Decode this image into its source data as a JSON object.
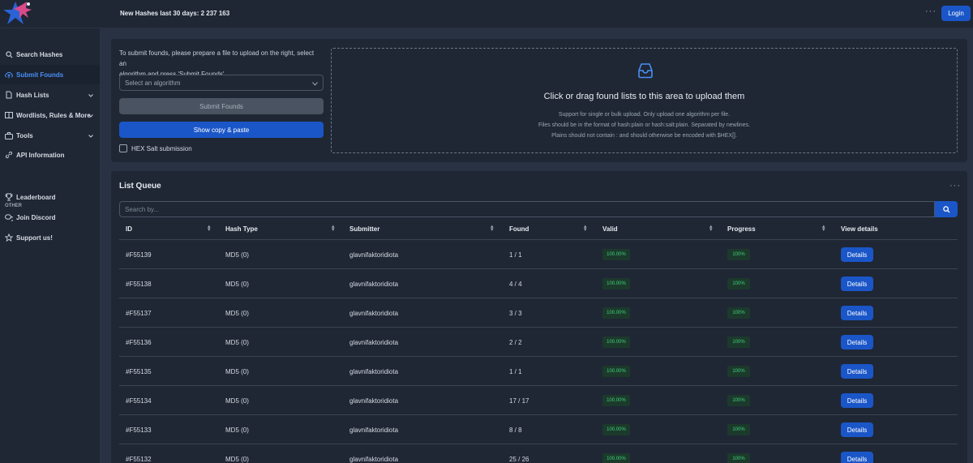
{
  "header": {
    "hashes_stat": "New Hashes last 30 days: 2 237 163",
    "more_label": "···",
    "login_label": "Login"
  },
  "sidebar": {
    "items": [
      {
        "label": "Search Hashes",
        "icon": "search-icon"
      },
      {
        "label": "Submit Founds",
        "icon": "cloud-upload-icon"
      },
      {
        "label": "Hash Lists",
        "icon": "file-icon"
      },
      {
        "label": "Wordlists, Rules & More",
        "icon": "book-icon"
      },
      {
        "label": "Tools",
        "icon": "toolbox-icon"
      },
      {
        "label": "API Information",
        "icon": "link-icon"
      }
    ],
    "section_label": "OTHER",
    "other_items": [
      {
        "label": "Leaderboard",
        "icon": "trophy-icon"
      },
      {
        "label": "Join Discord",
        "icon": "chat-icon"
      },
      {
        "label": "Support us!",
        "icon": "star-icon"
      }
    ]
  },
  "submit": {
    "intro_line1": "To submit founds, please prepare a file to upload on the right, select an",
    "intro_line2": "algorithm and press 'Submit Founds'.",
    "select_placeholder": "Select an algorithm",
    "submit_label": "Submit Founds",
    "copy_label": "Show copy & paste",
    "hex_label": "HEX Salt submission",
    "dropzone_title": "Click or drag found lists to this area to upload them",
    "hint1": "Support for single or bulk upload. Only upload one algorithm per file.",
    "hint2": "Files should be in the format of hash:plain or hash:salt:plain. Separated by newlines.",
    "hint3": "Plains should not contain : and should otherwise be encoded with $HEX[]."
  },
  "queue": {
    "title": "List Queue",
    "more_label": "···",
    "search_placeholder": "Search by...",
    "columns": [
      "ID",
      "Hash Type",
      "Submitter",
      "Found",
      "Valid",
      "Progress",
      "View details"
    ],
    "details_label": "Details",
    "rows": [
      {
        "id": "#F55139",
        "hash_type": "MD5 (0)",
        "submitter": "glavnifaktoridiota",
        "found": "1 / 1",
        "valid": "100.00%",
        "progress": "100%"
      },
      {
        "id": "#F55138",
        "hash_type": "MD5 (0)",
        "submitter": "glavnifaktoridiota",
        "found": "4 / 4",
        "valid": "100.00%",
        "progress": "100%"
      },
      {
        "id": "#F55137",
        "hash_type": "MD5 (0)",
        "submitter": "glavnifaktoridiota",
        "found": "3 / 3",
        "valid": "100.00%",
        "progress": "100%"
      },
      {
        "id": "#F55136",
        "hash_type": "MD5 (0)",
        "submitter": "glavnifaktoridiota",
        "found": "2 / 2",
        "valid": "100.00%",
        "progress": "100%"
      },
      {
        "id": "#F55135",
        "hash_type": "MD5 (0)",
        "submitter": "glavnifaktoridiota",
        "found": "1 / 1",
        "valid": "100.00%",
        "progress": "100%"
      },
      {
        "id": "#F55134",
        "hash_type": "MD5 (0)",
        "submitter": "glavnifaktoridiota",
        "found": "17 / 17",
        "valid": "100.00%",
        "progress": "100%"
      },
      {
        "id": "#F55133",
        "hash_type": "MD5 (0)",
        "submitter": "glavnifaktoridiota",
        "found": "8 / 8",
        "valid": "100.00%",
        "progress": "100%"
      },
      {
        "id": "#F55132",
        "hash_type": "MD5 (0)",
        "submitter": "glavnifaktoridiota",
        "found": "25 / 26",
        "valid": "100.00%",
        "progress": "100%"
      }
    ]
  },
  "colors": {
    "accent": "#1a56c8",
    "active_nav": "#4a8ff5",
    "badge_text": "#3fd07a",
    "background": "#1f2734"
  }
}
